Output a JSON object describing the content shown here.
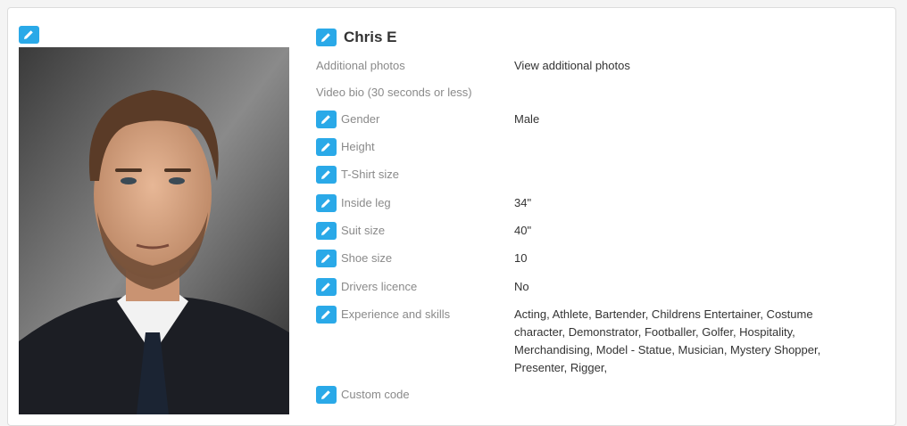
{
  "profile": {
    "name": "Chris E",
    "fields": {
      "additional_photos": {
        "label": "Additional photos",
        "value": "View additional photos"
      },
      "video_bio": {
        "label": "Video bio (30 seconds or less)",
        "value": ""
      },
      "gender": {
        "label": "Gender",
        "value": "Male"
      },
      "height": {
        "label": "Height",
        "value": ""
      },
      "tshirt": {
        "label": "T-Shirt size",
        "value": ""
      },
      "inside_leg": {
        "label": "Inside leg",
        "value": "34\""
      },
      "suit_size": {
        "label": "Suit size",
        "value": "40\""
      },
      "shoe_size": {
        "label": "Shoe size",
        "value": "10"
      },
      "drivers_licence": {
        "label": "Drivers licence",
        "value": "No"
      },
      "experience": {
        "label": "Experience and skills",
        "value": "Acting, Athlete, Bartender, Childrens Entertainer, Costume character, Demonstrator, Footballer, Golfer, Hospitality, Merchandising, Model - Statue, Musician, Mystery Shopper, Presenter, Rigger,"
      },
      "custom_code": {
        "label": "Custom code",
        "value": ""
      }
    }
  },
  "icons": {
    "edit": "pencil-icon"
  },
  "colors": {
    "accent": "#2aa9e8",
    "label": "#8a8a8a",
    "text": "#333333"
  }
}
